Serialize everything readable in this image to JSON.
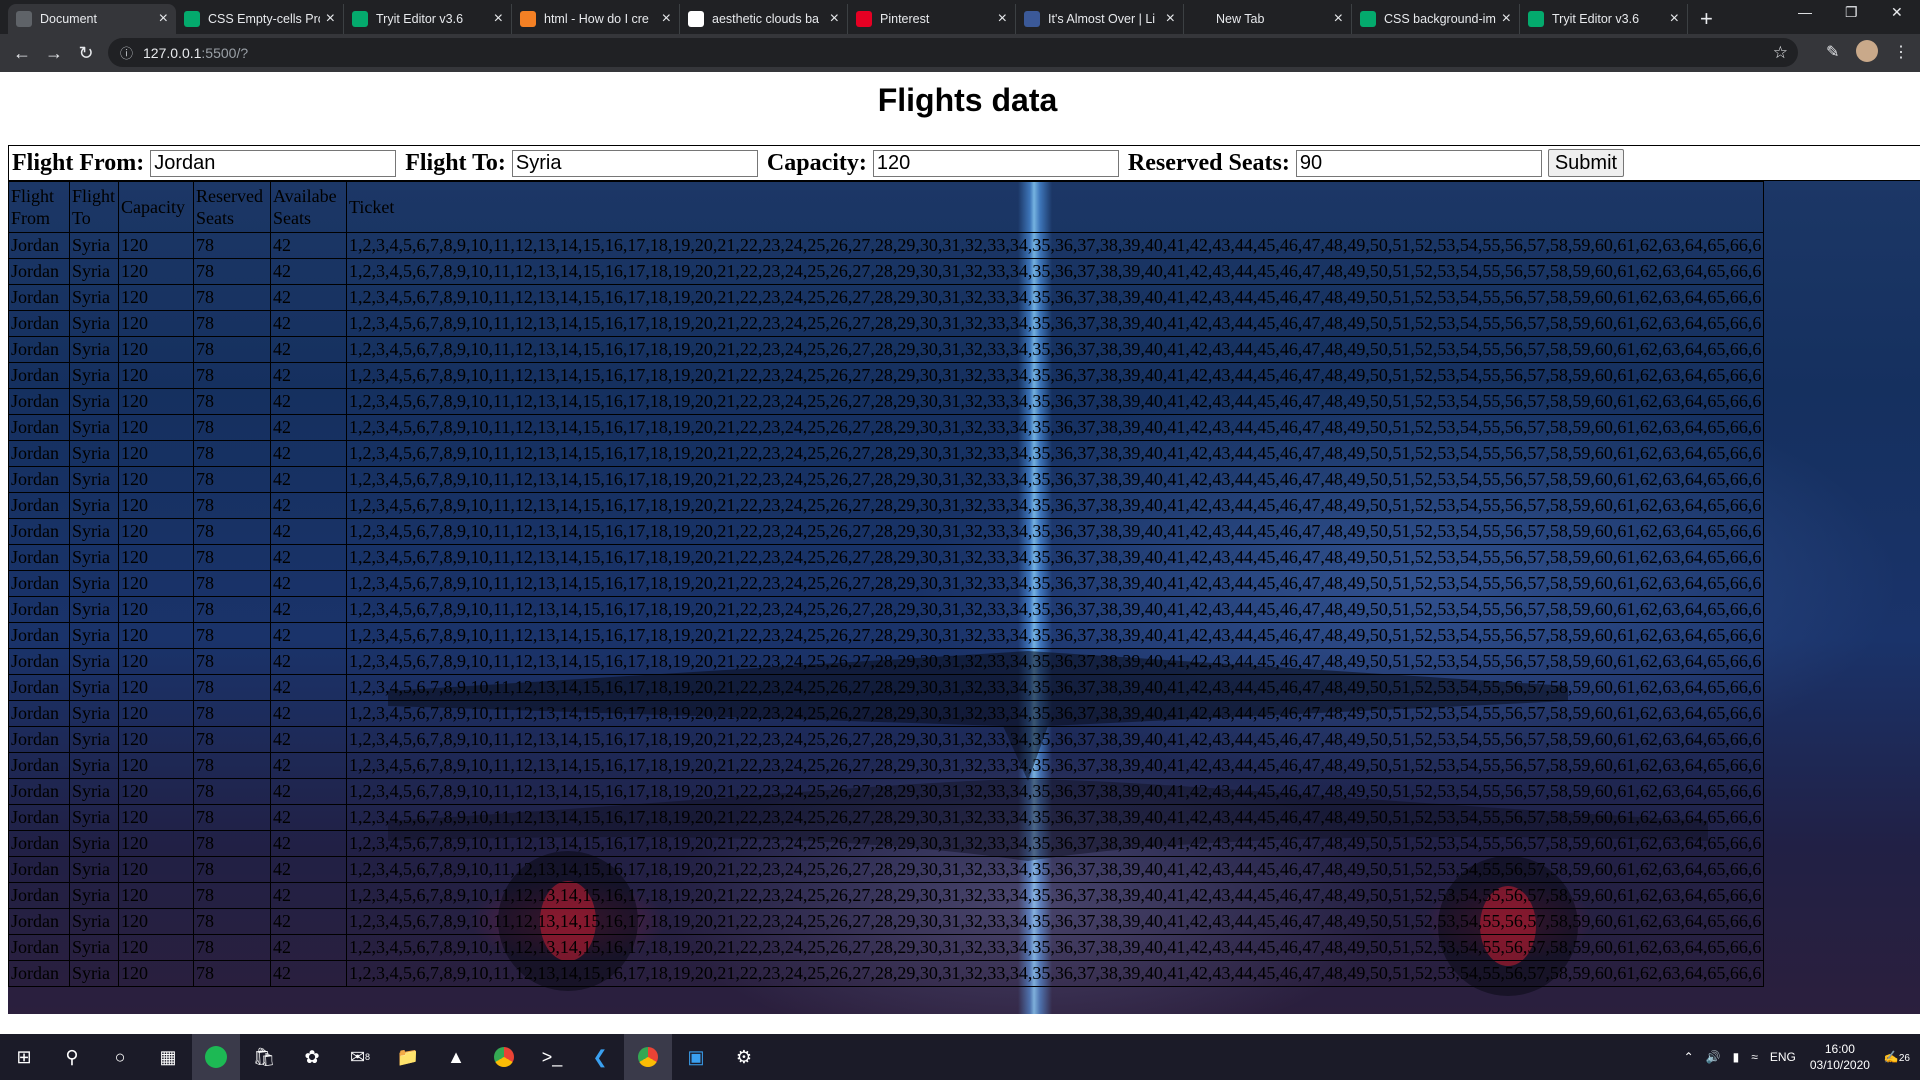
{
  "browser": {
    "tabs": [
      {
        "label": "Document",
        "icon": "chrome-page-icon",
        "active": true
      },
      {
        "label": "CSS Empty-cells Pro",
        "icon": "w3schools-icon"
      },
      {
        "label": "Tryit Editor v3.6",
        "icon": "w3schools-icon"
      },
      {
        "label": "html - How do I cre",
        "icon": "stackoverflow-icon"
      },
      {
        "label": "aesthetic clouds ba",
        "icon": "google-icon"
      },
      {
        "label": "Pinterest",
        "icon": "pinterest-icon"
      },
      {
        "label": "It's Almost Over | Li",
        "icon": "site-icon"
      },
      {
        "label": "New Tab",
        "icon": ""
      },
      {
        "label": "CSS background-im",
        "icon": "w3schools-icon"
      },
      {
        "label": "Tryit Editor v3.6",
        "icon": "w3schools-icon"
      }
    ],
    "url_host": "127.0.0.1",
    "url_path": ":5500/?"
  },
  "page": {
    "title": "Flights data",
    "form": {
      "from_label": "Flight From:",
      "from_value": "Jordan",
      "to_label": "Flight To:",
      "to_value": "Syria",
      "capacity_label": "Capacity:",
      "capacity_value": "120",
      "reserved_label": "Reserved Seats:",
      "reserved_value": "90",
      "submit_label": "Submit"
    },
    "table": {
      "headers": [
        "Flight From",
        "Flight To",
        "Capacity",
        "Reserved Seats",
        "Availabe Seats",
        "Ticket"
      ],
      "row": {
        "from": "Jordan",
        "to": "Syria",
        "capacity": "120",
        "reserved": "78",
        "available": "42",
        "ticket": "1,2,3,4,5,6,7,8,9,10,11,12,13,14,15,16,17,18,19,20,21,22,23,24,25,26,27,28,29,30,31,32,33,34,35,36,37,38,39,40,41,42,43,44,45,46,47,48,49,50,51,52,53,54,55,56,57,58,59,60,61,62,63,64,65,66,6"
      },
      "row_count": 29
    }
  },
  "taskbar": {
    "language": "ENG",
    "time": "16:00",
    "date": "03/10/2020",
    "notifications": "26",
    "mail_badge": "8"
  }
}
